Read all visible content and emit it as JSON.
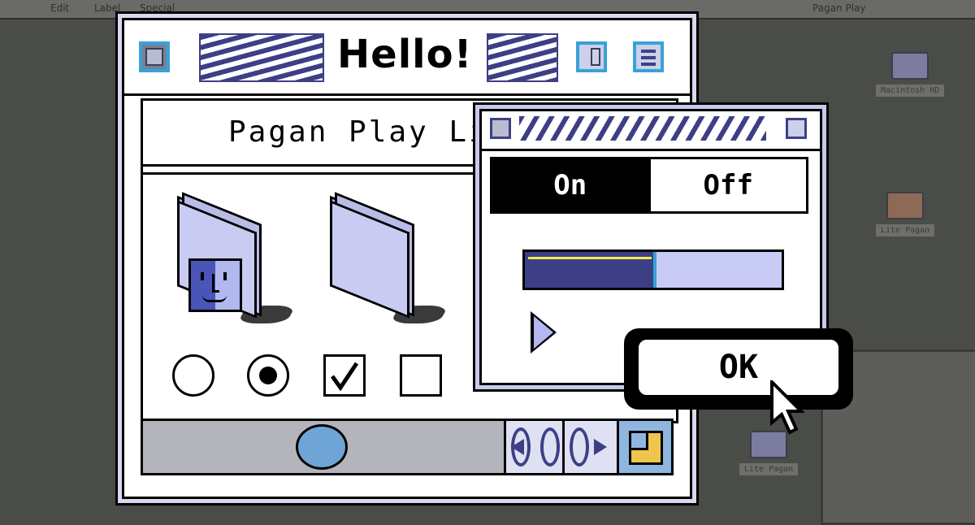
{
  "desktop": {
    "menu_items": [
      "Edit",
      "Label",
      "Special"
    ],
    "status": "Pagan Play",
    "icons": [
      {
        "label": "Macintosh HD"
      },
      {
        "label": "Lite Pagan"
      },
      {
        "label": "Lite Pagan"
      }
    ]
  },
  "main_window": {
    "title": "Hello!",
    "header_text": "Pagan Play Lit",
    "controls": {
      "radio_1_checked": false,
      "radio_2_checked": true,
      "checkbox_1_checked": true,
      "checkbox_2_checked": false
    }
  },
  "small_window": {
    "toggle": {
      "on_label": "On",
      "off_label": "Off",
      "selected": "On"
    },
    "progress": 0.5
  },
  "ok_button": {
    "label": "OK"
  },
  "colors": {
    "accent_blue": "#38a2d9",
    "navy": "#3d3f86",
    "lavender": "#c8cbf5",
    "thumb": "#6fa4d6"
  }
}
